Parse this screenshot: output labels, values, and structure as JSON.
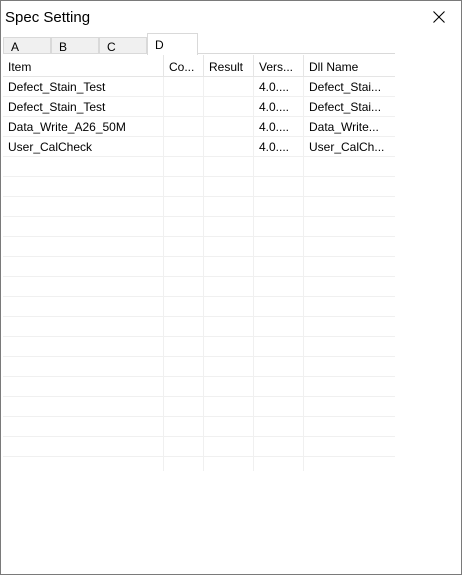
{
  "window": {
    "title": "Spec Setting"
  },
  "tabs": [
    {
      "label": "A"
    },
    {
      "label": "B"
    },
    {
      "label": "C"
    },
    {
      "label": "D"
    }
  ],
  "table": {
    "columns": [
      "Item",
      "Co...",
      "Result",
      "Vers...",
      "Dll Name"
    ],
    "rows": [
      [
        "Defect_Stain_Test",
        "",
        "",
        "4.0....",
        "Defect_Stai..."
      ],
      [
        "Defect_Stain_Test",
        "",
        "",
        "4.0....",
        "Defect_Stai..."
      ],
      [
        "Data_Write_A26_50M",
        "",
        "",
        "4.0....",
        "Data_Write..."
      ],
      [
        "User_CalCheck",
        "",
        "",
        "4.0....",
        "User_CalCh..."
      ]
    ]
  }
}
